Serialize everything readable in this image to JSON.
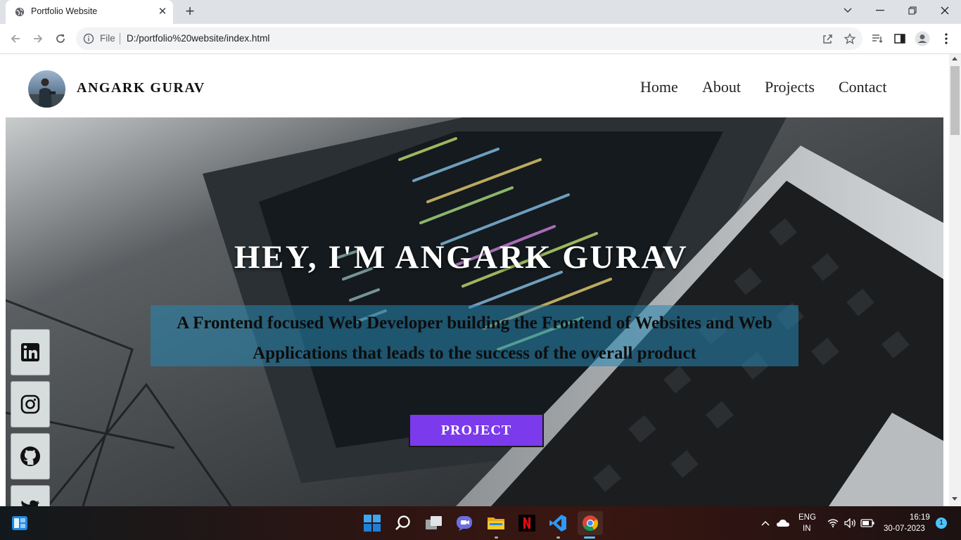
{
  "browser": {
    "tab_title": "Portfolio Website",
    "url_scheme_label": "File",
    "url": "D:/portfolio%20website/index.html"
  },
  "site": {
    "brand_name": "ANGARK GURAV",
    "nav": [
      "Home",
      "About",
      "Projects",
      "Contact"
    ],
    "hero_title": "HEY, I'M ANGARK GURAV",
    "hero_subtitle_line1": "A Frontend focused Web Developer building the Frontend of Websites and Web",
    "hero_subtitle_line2": "Applications that leads to the success of the overall product",
    "hero_button": "PROJECT",
    "social_icons": [
      "linkedin-icon",
      "instagram-icon",
      "github-icon",
      "twitter-icon"
    ],
    "accent_color": "#7c3aed"
  },
  "taskbar": {
    "apps": [
      "windows-start-icon",
      "search-icon",
      "task-view-icon",
      "chat-icon",
      "file-explorer-icon",
      "netflix-icon",
      "vscode-icon",
      "chrome-icon"
    ],
    "language_line1": "ENG",
    "language_line2": "IN",
    "time": "16:19",
    "date": "30-07-2023",
    "notification_count": "1"
  }
}
